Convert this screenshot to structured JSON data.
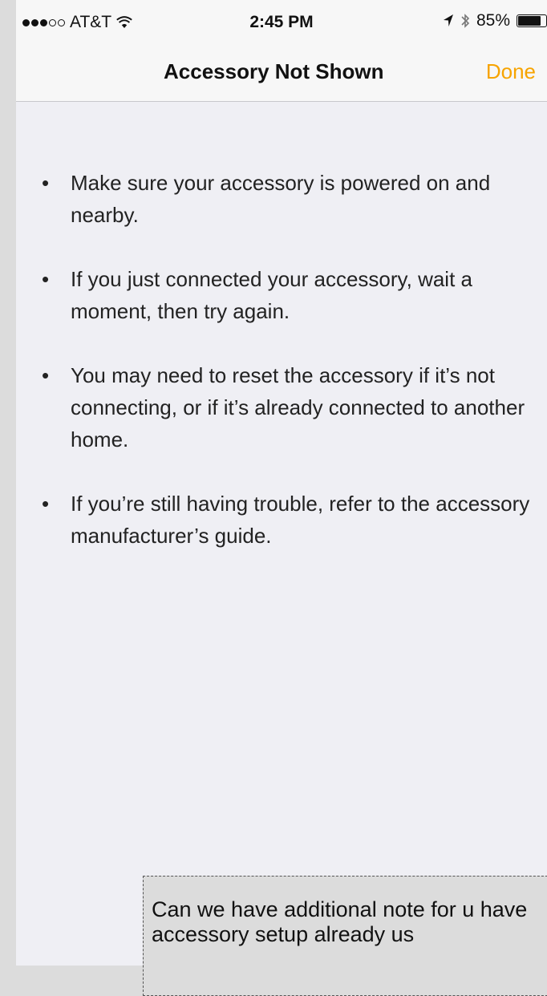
{
  "status_bar": {
    "carrier": "AT&T",
    "time": "2:45 PM",
    "battery_text": "85%",
    "battery_level": 0.85,
    "signal_dots_filled": 3,
    "signal_dots_total": 5
  },
  "nav": {
    "title": "Accessory Not Shown",
    "done_label": "Done"
  },
  "tips": [
    {
      "text": "Make sure your accessory is powered on and nearby."
    },
    {
      "text": "If you just connected your accessory, wait a moment, then try again."
    },
    {
      "text": "You may need to reset the accessory if it’s not connecting, or if it’s already connected to another home."
    },
    {
      "text": "If you’re still having trouble, refer to the accessory manufacturer’s guide."
    }
  ],
  "note": {
    "text": "Can we have additional note for u have accessory setup already us"
  },
  "colors": {
    "accent": "#f7a400",
    "background": "#efeff4",
    "bar": "#f7f7f7"
  }
}
